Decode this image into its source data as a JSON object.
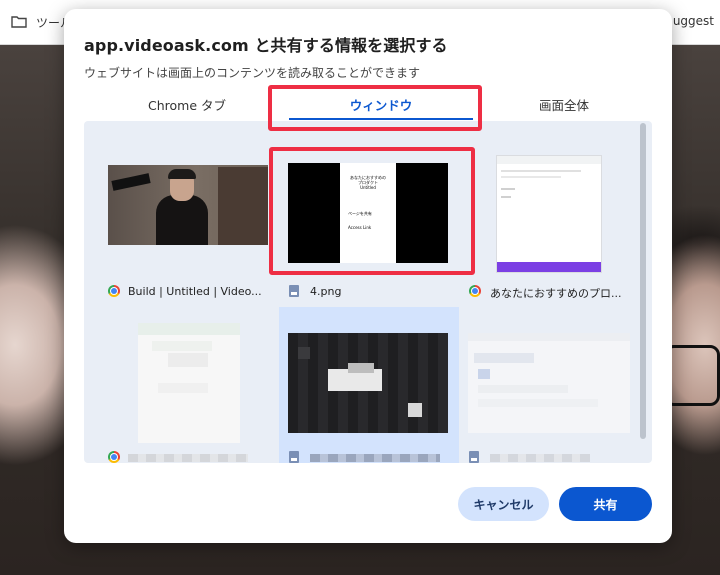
{
  "background": {
    "bar_label": "ツール",
    "bar_right_text": "uggest"
  },
  "dialog": {
    "title": "app.videoask.com と共有する情報を選択する",
    "subtitle": "ウェブサイトは画面上のコンテンツを読み取ることができます",
    "tabs": [
      {
        "label": "Chrome タブ",
        "selected": false
      },
      {
        "label": "ウィンドウ",
        "selected": true
      },
      {
        "label": "画面全体",
        "selected": false
      }
    ],
    "windows": [
      {
        "title": "Build | Untitled | Video...",
        "icon": "chrome-icon"
      },
      {
        "title": "4.png",
        "icon": "file-icon"
      },
      {
        "title": "あなたにおすすめのプロ...",
        "icon": "chrome-icon"
      },
      {
        "title": "",
        "icon": "chrome-icon"
      },
      {
        "title": "",
        "icon": "file-icon"
      },
      {
        "title": "",
        "icon": "file-icon"
      }
    ],
    "thumb_text": [
      "あなたにおすすめの",
      "プロダクト",
      "Untitled",
      "ページを共有",
      "Access",
      "Link"
    ],
    "buttons": {
      "cancel": "キャンセル",
      "share": "共有"
    }
  },
  "colors": {
    "accent": "#0b57d0",
    "highlight": "#ee2e44",
    "selected_bg": "#d3e3fd"
  }
}
